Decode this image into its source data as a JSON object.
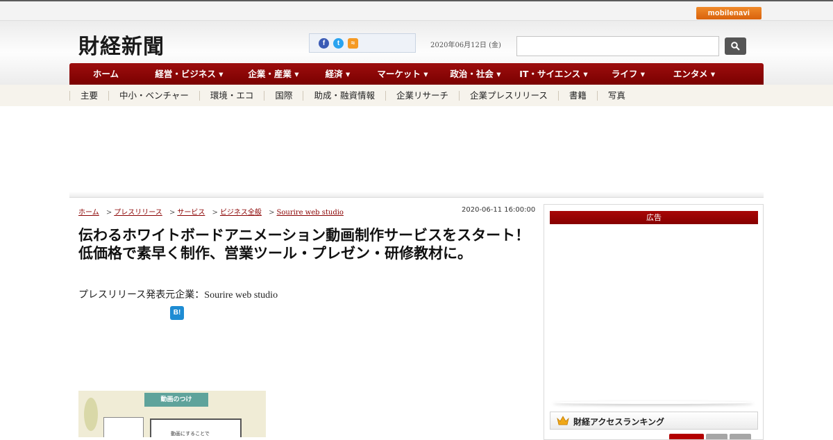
{
  "topbar": {
    "mobile_badge": "mobilenavi"
  },
  "header": {
    "logo": "財経新聞",
    "date": "2020年06月12日 (金)",
    "search": {
      "placeholder": ""
    },
    "social_icons": [
      "facebook-icon",
      "twitter-icon",
      "rss-icon"
    ]
  },
  "main_nav": {
    "items": [
      "ホーム",
      "経営・ビジネス ▾",
      "企業・産業 ▾",
      "経済 ▾",
      "マーケット ▾",
      "政治・社会 ▾",
      "IT・サイエンス ▾",
      "ライフ ▾",
      "エンタメ ▾"
    ]
  },
  "sub_nav": {
    "items": [
      "主要",
      "中小・ベンチャー",
      "環境・エコ",
      "国際",
      "助成・融資情報",
      "企業リサーチ",
      "企業プレスリリース",
      "書籍",
      "写真"
    ]
  },
  "breadcrumb": {
    "items": [
      "ホーム",
      "プレスリリース",
      "サービス",
      "ビジネス全般",
      "Sourire web studio"
    ],
    "separator": ">"
  },
  "article": {
    "published": "2020-06-11 16:00:00",
    "title": "伝わるホワイトボードアニメーション動画制作サービスをスタート！低価格で素早く制作、営業ツール・プレゼン・研修教材に。",
    "source": "プレスリリース発表元企業：Sourire web studio",
    "hatena_label": "B!",
    "thumbnail": {
      "banner": "動画のつけ",
      "board_text": "動画にすることで"
    }
  },
  "sidebar": {
    "ad_label": "広告",
    "ranking_title": "財経アクセスランキング"
  },
  "colors": {
    "nav_red": "#8a0000",
    "accent_orange": "#e8741c"
  }
}
